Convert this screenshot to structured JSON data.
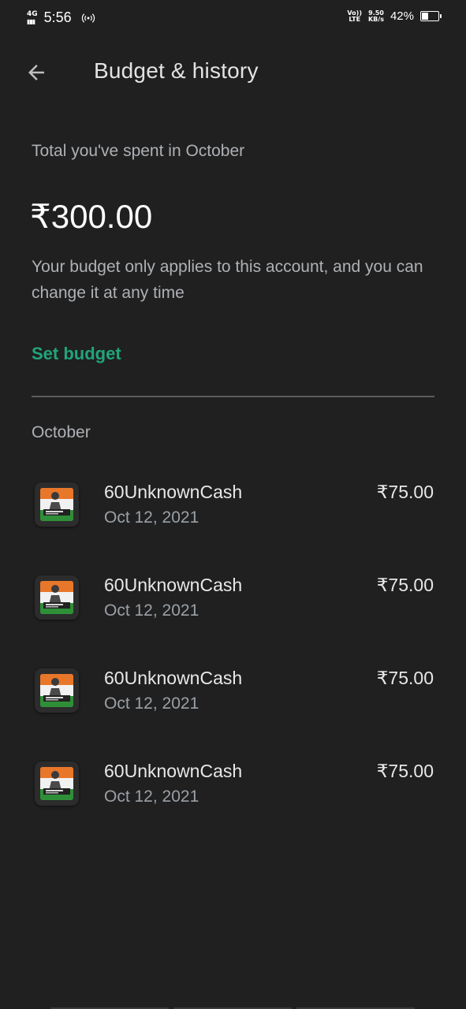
{
  "status_bar": {
    "network": "4G",
    "time": "5:56",
    "volte_top": "Vo))",
    "volte_bottom": "LTE",
    "speed_value": "9.50",
    "speed_unit": "KB/s",
    "battery_percent": "42%",
    "battery_level": 0.42
  },
  "header": {
    "title": "Budget & history",
    "back_icon": "arrow-back-icon"
  },
  "summary": {
    "spent_label": "Total you've spent in October",
    "spent_amount": "₹300.00",
    "budget_note": "Your budget only applies to this account, and you can change it at any time",
    "set_budget_label": "Set budget"
  },
  "history": {
    "month": "October",
    "transactions": [
      {
        "name": "60UnknownCash",
        "date": "Oct 12, 2021",
        "amount": "₹75.00",
        "icon": "battlegrounds-mobile-india-app-icon"
      },
      {
        "name": "60UnknownCash",
        "date": "Oct 12, 2021",
        "amount": "₹75.00",
        "icon": "battlegrounds-mobile-india-app-icon"
      },
      {
        "name": "60UnknownCash",
        "date": "Oct 12, 2021",
        "amount": "₹75.00",
        "icon": "battlegrounds-mobile-india-app-icon"
      },
      {
        "name": "60UnknownCash",
        "date": "Oct 12, 2021",
        "amount": "₹75.00",
        "icon": "battlegrounds-mobile-india-app-icon"
      }
    ]
  },
  "colors": {
    "background": "#202020",
    "accent": "#21a47a",
    "text_primary": "#e8e8e8",
    "text_secondary": "#aeb1b5"
  }
}
